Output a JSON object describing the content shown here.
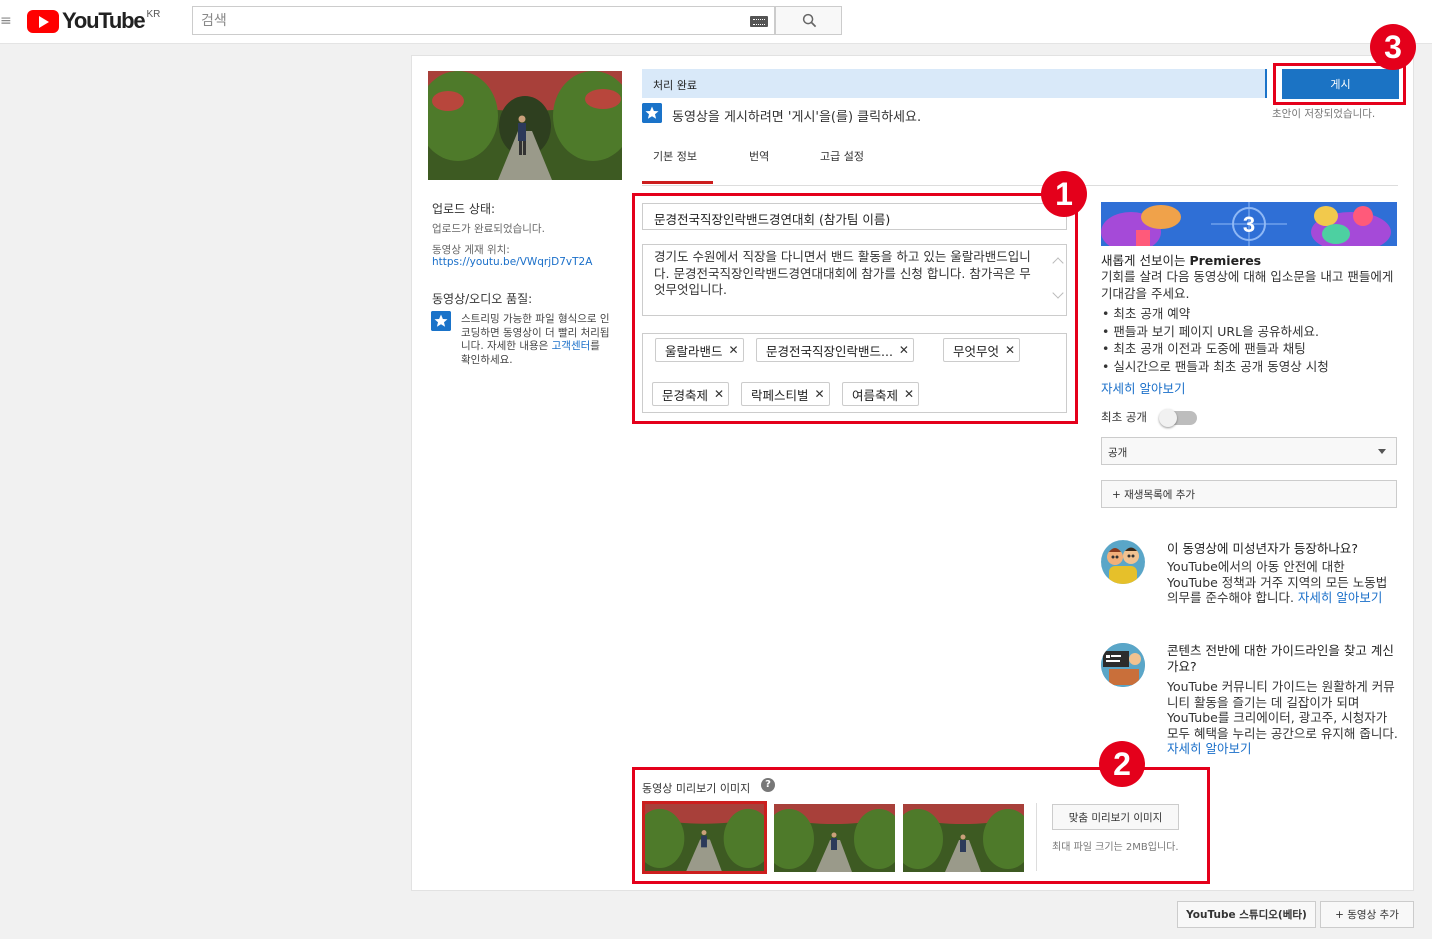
{
  "masthead": {
    "logo_text": "YouTube",
    "country_code": "KR",
    "search_placeholder": "검색"
  },
  "left_panel": {
    "upload_status_label": "업로드 상태:",
    "upload_status_text": "업로드가 완료되었습니다.",
    "video_location_label": "동영상 게재 위치:",
    "video_url": "https://youtu.be/VWqrjD7vT2A",
    "quality_label": "동영상/오디오 품질:",
    "quality_text_pre": "스트리밍 가능한 파일 형식으로 인코딩하면 동영상이 더 빨리 처리됩니다. 자세한 내용은 ",
    "quality_link": "고객센터",
    "quality_text_post": "를 확인하세요."
  },
  "status": {
    "processing": "처리 완료",
    "publish_hint": "동영상을 게시하려면 '게시'을(를) 클릭하세요.",
    "publish_button": "게시",
    "draft_saved": "초안이 저장되었습니다."
  },
  "tabs": [
    {
      "label": "기본 정보",
      "active": true
    },
    {
      "label": "번역",
      "active": false
    },
    {
      "label": "고급 설정",
      "active": false
    }
  ],
  "basic_info": {
    "title": "문경전국직장인락밴드경연대회 (참가팀 이름)",
    "description": "경기도 수원에서 직장을 다니면서 밴드 활동을 하고 있는 울랄라밴드입니다. 문경전국직장인락밴드경연대대회에 참가를 신청 합니다. 참가곡은 무엇무엇입니다.",
    "tags": [
      "울랄라밴드",
      "문경전국직장인락밴드...",
      "무엇무엇",
      "문경축제",
      "락페스티벌",
      "여름축제"
    ]
  },
  "thumbnails": {
    "label": "동영상 미리보기 이미지",
    "custom_button": "맞춤 미리보기 이미지",
    "max_size": "최대 파일 크기는 2MB입니다.",
    "selected_index": 0
  },
  "premieres": {
    "banner_number": "3",
    "title_pre": "새롭게 선보이는 ",
    "title_bold": "Premieres",
    "description": "기회를 살려 다음 동영상에 대해 입소문을 내고 팬들에게 기대감을 주세요.",
    "items": [
      "최초 공개 예약",
      "팬들과 보기 페이지 URL을 공유하세요.",
      "최초 공개 이전과 도중에 팬들과 채팅",
      "실시간으로 팬들과 최초 공개 동영상 시청"
    ],
    "learn_more": "자세히 알아보기",
    "toggle_label": "최초 공개",
    "toggle_on": false,
    "privacy_value": "공개",
    "add_playlist": "+ 재생목록에 추가"
  },
  "minor_block": {
    "title": "이 동영상에 미성년자가 등장하나요?",
    "text": "YouTube에서의 아동 안전에 대한 YouTube 정책과 거주 지역의 모든 노동법 의무를 준수해야 합니다. ",
    "link": "자세히 알아보기"
  },
  "guide_block": {
    "title": "콘텐츠 전반에 대한 가이드라인을 찾고 계신가요?",
    "text": "YouTube 커뮤니티 가이드는 원활하게 커뮤니티 활동을 즐기는 데 길잡이가 되며 YouTube를 크리에이터, 광고주, 시청자가 모두 혜택을 누리는 공간으로 유지해 줍니다. ",
    "link": "자세히 알아보기"
  },
  "callouts": [
    "1",
    "2",
    "3"
  ],
  "footer": {
    "studio_button": "YouTube 스튜디오(베타)",
    "add_video_button": "+ 동영상 추가"
  },
  "colors": {
    "accent_blue": "#1b73c4",
    "callout_red": "#e4001b",
    "link_blue": "#1a6fc9"
  }
}
